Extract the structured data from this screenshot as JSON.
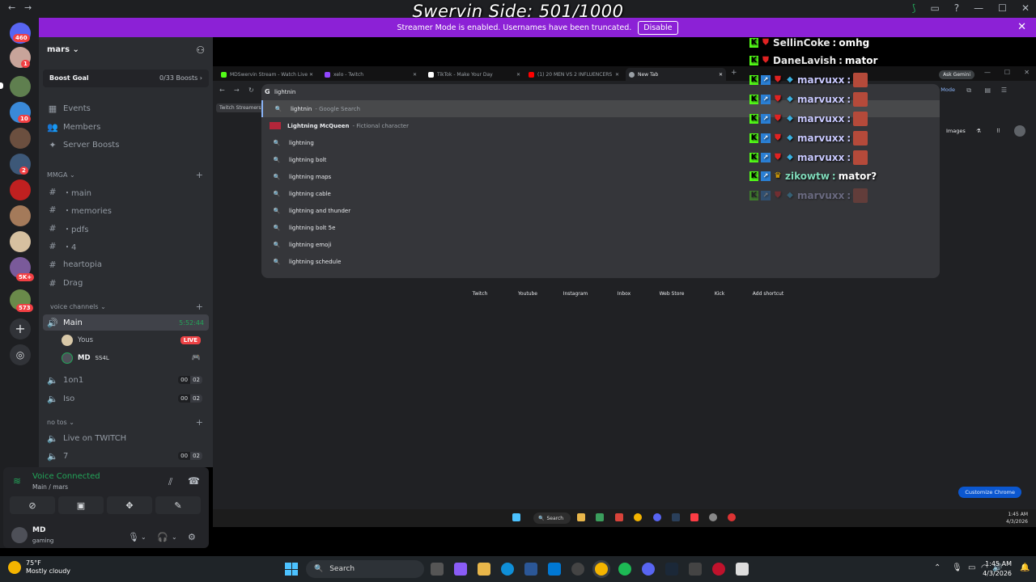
{
  "overlay": {
    "title": "Swervin Side: 501/1000"
  },
  "window": {
    "back": "←",
    "forward": "→",
    "leaf": "⟆",
    "min": "—",
    "max": "☐",
    "close": "✕",
    "help": "?"
  },
  "banner": {
    "text": "Streamer Mode is enabled. Usernames have been truncated.",
    "button": "Disable",
    "close": "✕"
  },
  "rail": {
    "badges": [
      "460",
      "1",
      "10",
      "2",
      "5K+",
      "573"
    ]
  },
  "guild": {
    "name": "mars ⌄",
    "boost_label": "Boost Goal",
    "boost_value": "0/33 Boosts ›"
  },
  "channels": {
    "top": [
      {
        "icon": "▦",
        "label": "Events"
      },
      {
        "icon": "👥",
        "label": "Members"
      },
      {
        "icon": "✦",
        "label": "Server Boosts"
      }
    ],
    "cat1": "MMGA ⌄",
    "text": [
      {
        "label": "・main"
      },
      {
        "label": "・memories"
      },
      {
        "label": "・pdfs"
      },
      {
        "label": "・4"
      },
      {
        "label": "heartopia"
      },
      {
        "label": "Drag"
      }
    ],
    "cat2": "voice channels ⌄",
    "voice_main": {
      "label": "Main",
      "time": "5:52:44"
    },
    "users": [
      {
        "name": "Yous",
        "badge": "LIVE"
      },
      {
        "name": "MD",
        "tag": "SS4L"
      }
    ],
    "voice_other": [
      {
        "label": "1on1",
        "a": "00",
        "b": "02"
      },
      {
        "label": "Iso",
        "a": "00",
        "b": "02"
      }
    ],
    "cat3": "no tos ⌄",
    "tos": [
      {
        "label": "Live on TWITCH"
      },
      {
        "label": "7",
        "a": "00",
        "b": "02"
      }
    ]
  },
  "voice": {
    "status": "Voice Connected",
    "sub": "Main / mars"
  },
  "me": {
    "name": "MD",
    "status": "gaming"
  },
  "browser": {
    "tabs": [
      {
        "label": "MDSwervin Stream - Watch Live",
        "color": "#53fc18"
      },
      {
        "label": "xelo - Twitch",
        "color": "#9146ff"
      },
      {
        "label": "TikTok - Make Your Day",
        "color": "#ffffff"
      },
      {
        "label": "(1) 20 MEN VS 2 INFLUENCERS",
        "color": "#ff0000"
      },
      {
        "label": "New Tab",
        "color": "#9aa0a6"
      }
    ],
    "ask_gemini": "Ask Gemini",
    "ai_mode": "AI Mode",
    "bookmark": "Twitch Streamers",
    "omnibox_value": "lightnin",
    "suggestions": [
      {
        "text": "lightnin",
        "sub": "- Google Search"
      },
      {
        "text": "Lightning McQueen",
        "sub": "- Fictional character"
      },
      {
        "text": "lightning",
        "sub": ""
      },
      {
        "text": "lightning bolt",
        "sub": ""
      },
      {
        "text": "lightning maps",
        "sub": ""
      },
      {
        "text": "lightning cable",
        "sub": ""
      },
      {
        "text": "lightning and thunder",
        "sub": ""
      },
      {
        "text": "lightning bolt 5e",
        "sub": ""
      },
      {
        "text": "lightning emoji",
        "sub": ""
      },
      {
        "text": "lightning schedule",
        "sub": ""
      }
    ],
    "images": "Images",
    "shortcuts": [
      "Twitch",
      "Youtube",
      "Instagram",
      "Inbox",
      "Web Store",
      "Kick",
      "Add shortcut"
    ],
    "customize": "Customize Chrome",
    "inner_search": "Search",
    "inner_time": "1:45 AM",
    "inner_date": "4/3/2026"
  },
  "chat": [
    {
      "user": "SellinCoke",
      "text": "omhg",
      "color": "#e8e8e8",
      "emote": false,
      "dim": false
    },
    {
      "user": "DaneLavish",
      "text": "mator",
      "color": "#e8e8e8",
      "emote": false,
      "dim": false
    },
    {
      "user": "marvuxx",
      "text": "",
      "color": "#c9c9ff",
      "emote": true,
      "dim": false
    },
    {
      "user": "marvuxx",
      "text": "",
      "color": "#c9c9ff",
      "emote": true,
      "dim": false
    },
    {
      "user": "marvuxx",
      "text": "",
      "color": "#c9c9ff",
      "emote": true,
      "dim": false
    },
    {
      "user": "marvuxx",
      "text": "",
      "color": "#c9c9ff",
      "emote": true,
      "dim": false
    },
    {
      "user": "marvuxx",
      "text": "",
      "color": "#c9c9ff",
      "emote": true,
      "dim": false
    },
    {
      "user": "zikowtw",
      "text": "mator?",
      "color": "#7fd9b9",
      "emote": false,
      "dim": false
    },
    {
      "user": "marvuxx",
      "text": "",
      "color": "#c9c9ff",
      "emote": true,
      "dim": true
    }
  ],
  "taskbar": {
    "temp": "75°F",
    "weather": "Mostly cloudy",
    "search": "Search",
    "time": "1:45 AM",
    "date": "4/3/2026"
  }
}
